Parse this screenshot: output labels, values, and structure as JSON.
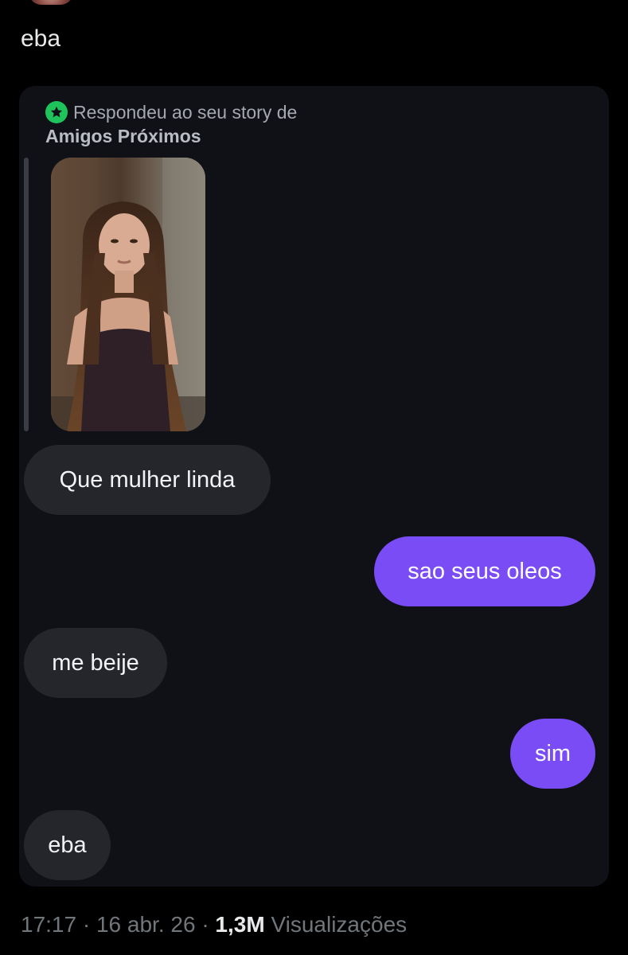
{
  "tweet": {
    "text": "eba"
  },
  "story_reply": {
    "line1": "Respondeu ao seu story de",
    "line2": "Amigos Próximos",
    "badge_color": "#1fc35c",
    "badge_icon": "star-icon",
    "thumbnail_description_icon": "story-photo"
  },
  "messages": [
    {
      "side": "received",
      "text": "Que mulher linda"
    },
    {
      "side": "sent",
      "text": "sao seus oleos"
    },
    {
      "side": "received",
      "text": "me beije"
    },
    {
      "side": "sent",
      "text": "sim"
    },
    {
      "side": "received",
      "text": "eba"
    }
  ],
  "colors": {
    "background": "#000000",
    "card": "#0f1116",
    "received_bubble": "#24262b",
    "sent_bubble": "#7a4cf5"
  },
  "footer": {
    "time": "17:17",
    "separator": "·",
    "date": "16 abr. 26",
    "views_count": "1,3M",
    "views_label": "Visualizações"
  }
}
